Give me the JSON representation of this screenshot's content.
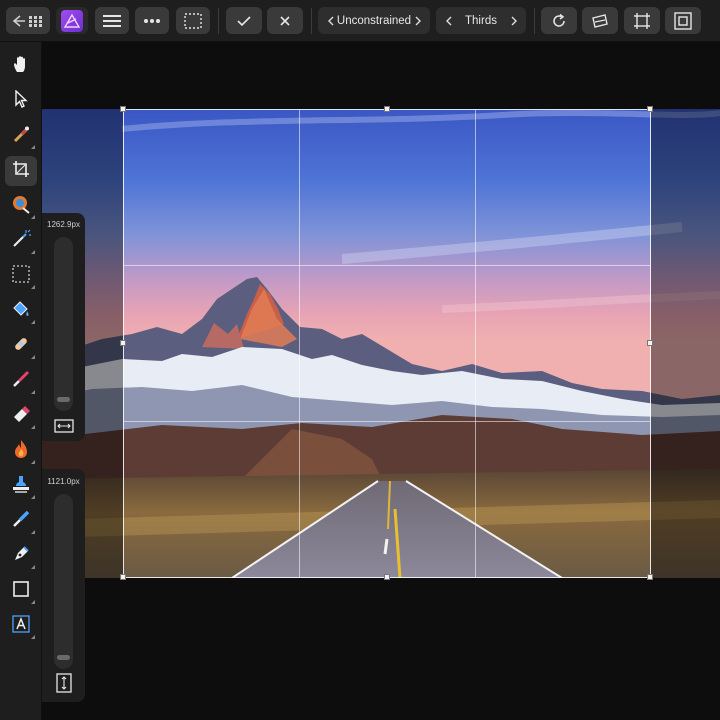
{
  "toolbar": {
    "back_icon": "back-arrow-grid-icon",
    "app_icon": "affinity-photo-logo",
    "menu_icon": "hamburger-menu-icon",
    "more_icon": "more-dots-icon",
    "selection_icon": "marquee-selection-icon",
    "commit_icon": "checkmark-icon",
    "cancel_icon": "close-icon",
    "constraint_mode": "Unconstrained",
    "overlay_mode": "Thirds",
    "reset_icon": "reset-rotate-icon",
    "straighten_icon": "straighten-icon",
    "crop_canvas_icon": "crop-canvas-icon",
    "fit_icon": "fit-frame-icon"
  },
  "tools": [
    {
      "name": "view-tool",
      "icon": "hand-icon",
      "active": false
    },
    {
      "name": "move-tool",
      "icon": "pointer-icon",
      "active": false
    },
    {
      "name": "color-picker-tool",
      "icon": "eyedropper-icon",
      "active": false
    },
    {
      "name": "crop-tool",
      "icon": "crop-icon",
      "active": true
    },
    {
      "name": "selection-brush-tool",
      "icon": "selection-brush-icon",
      "active": false
    },
    {
      "name": "flood-select-tool",
      "icon": "magic-wand-icon",
      "active": false
    },
    {
      "name": "marquee-tool",
      "icon": "marquee-icon",
      "active": false
    },
    {
      "name": "fill-tool",
      "icon": "paint-bucket-icon",
      "active": false
    },
    {
      "name": "healing-tool",
      "icon": "bandage-icon",
      "active": false
    },
    {
      "name": "paint-brush-tool",
      "icon": "paint-brush-icon",
      "active": false
    },
    {
      "name": "erase-tool",
      "icon": "eraser-icon",
      "active": false
    },
    {
      "name": "burn-tool",
      "icon": "flame-icon",
      "active": false
    },
    {
      "name": "clone-tool",
      "icon": "stamp-icon",
      "active": false
    },
    {
      "name": "retouch-tool",
      "icon": "brush-blend-icon",
      "active": false
    },
    {
      "name": "pen-tool",
      "icon": "pen-nib-icon",
      "active": false
    },
    {
      "name": "rectangle-tool",
      "icon": "rectangle-icon",
      "active": false
    },
    {
      "name": "text-tool",
      "icon": "text-frame-icon",
      "active": false
    }
  ],
  "crop": {
    "width_value": "1262.9px",
    "height_value": "1121.0px",
    "width_icon": "horizontal-resize-icon",
    "height_icon": "vertical-resize-icon"
  }
}
